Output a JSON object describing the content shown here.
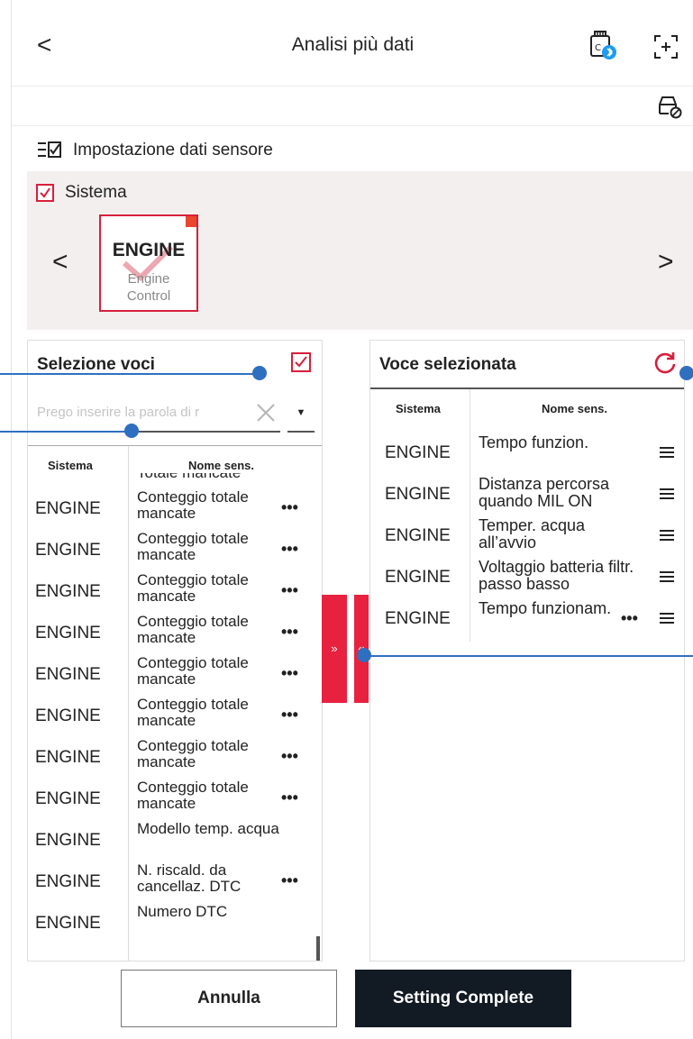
{
  "header": {
    "back_label": "<",
    "title": "Analisi più dati"
  },
  "section": {
    "title": "Impostazione dati sensore"
  },
  "system": {
    "label": "Sistema",
    "prev_label": "<",
    "next_label": ">",
    "card": {
      "title": "ENGINE",
      "subtitle_line1": "Engine",
      "subtitle_line2": "Control"
    }
  },
  "left_panel": {
    "title": "Selezione voci",
    "search_placeholder": "Prego inserire la parola di r",
    "dropdown_label": "▼",
    "headers": {
      "system": "Sistema",
      "name": "Nome sens."
    },
    "partial_top": "Totale mancate",
    "rows": [
      {
        "system": "ENGINE",
        "name": "Conteggio totale mancate",
        "more": "•••"
      },
      {
        "system": "ENGINE",
        "name": "Conteggio totale mancate",
        "more": "•••"
      },
      {
        "system": "ENGINE",
        "name": "Conteggio totale mancate",
        "more": "•••"
      },
      {
        "system": "ENGINE",
        "name": "Conteggio totale mancate",
        "more": "•••"
      },
      {
        "system": "ENGINE",
        "name": "Conteggio totale mancate",
        "more": "•••"
      },
      {
        "system": "ENGINE",
        "name": "Conteggio totale mancate",
        "more": "•••"
      },
      {
        "system": "ENGINE",
        "name": "Conteggio totale mancate",
        "more": "•••"
      },
      {
        "system": "ENGINE",
        "name": "Conteggio totale mancate",
        "more": "•••"
      },
      {
        "system": "ENGINE",
        "name": "Modello temp. acqua",
        "more": ""
      },
      {
        "system": "ENGINE",
        "name": "N. riscald. da cancellaz. DTC",
        "more": "•••"
      },
      {
        "system": "ENGINE",
        "name": "Numero DTC",
        "more": ""
      }
    ]
  },
  "transfer": {
    "add_label": "»",
    "remove_label": "«"
  },
  "right_panel": {
    "title": "Voce selezionata",
    "headers": {
      "system": "Sistema",
      "name": "Nome sens."
    },
    "rows": [
      {
        "system": "ENGINE",
        "name": "Tempo funzion.",
        "more": ""
      },
      {
        "system": "ENGINE",
        "name": "Distanza percorsa quando MIL ON",
        "more": ""
      },
      {
        "system": "ENGINE",
        "name": "Temper. acqua all’avvio",
        "more": ""
      },
      {
        "system": "ENGINE",
        "name": "Voltaggio batteria filtr. passo basso",
        "more": ""
      },
      {
        "system": "ENGINE",
        "name": "Tempo funzionam.",
        "more": "•••"
      }
    ]
  },
  "footer": {
    "cancel_label": "Annulla",
    "confirm_label": "Setting Complete"
  },
  "colors": {
    "accent": "#d81f3b",
    "transfer": "#e8213e",
    "confirm_bg": "#121a24",
    "panel_bg": "#f3efef",
    "callout": "#2f6fc0"
  },
  "icons": {
    "back": "chevron-left-icon",
    "vci": "vci-bluetooth-icon",
    "scan": "scan-frame-icon",
    "vehicle": "vehicle-check-icon",
    "section": "list-check-icon",
    "refresh": "refresh-icon",
    "drag": "drag-handle-icon",
    "clear": "close-icon"
  }
}
